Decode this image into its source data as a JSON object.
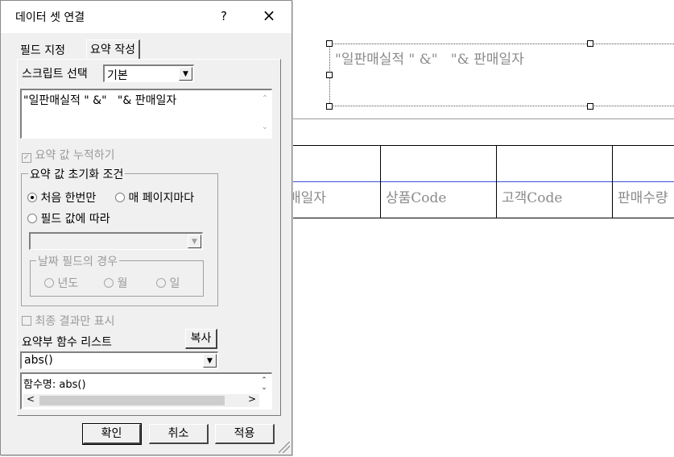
{
  "dialog": {
    "title": "데이터 셋 연결",
    "help_label": "?",
    "close_label": "×",
    "tabs": [
      {
        "label": "필드 지정",
        "active": false
      },
      {
        "label": "요약 작성",
        "active": true
      }
    ],
    "script_select": {
      "label": "스크립트 선택",
      "value": "기본"
    },
    "script_text": "\"일판매실적 \" &\"   \"& 판매일자",
    "accumulate_checkbox": {
      "label": "요약 값 누적하기",
      "checked": true,
      "enabled": false
    },
    "reset_group": {
      "title": "요약 값 초기화 조건",
      "options": {
        "first_only": {
          "label": "처음 한번만",
          "selected": true
        },
        "every_page": {
          "label": "매 페이지마다",
          "selected": false
        },
        "by_field": {
          "label": "필드 값에 따라",
          "selected": false
        }
      },
      "field_combo_value": "",
      "date_group": {
        "title": "날짜 필드의 경우",
        "options": [
          {
            "label": "년도"
          },
          {
            "label": "월"
          },
          {
            "label": "일"
          }
        ]
      }
    },
    "final_only_checkbox": {
      "label": "최종 결과만 표시",
      "checked": false,
      "enabled": false
    },
    "function_list": {
      "label": "요약부 함수 리스트",
      "copy_button": "복사",
      "value": "abs()"
    },
    "function_info": "함수명: abs()",
    "buttons": {
      "ok": "확인",
      "cancel": "취소",
      "apply": "적용"
    }
  },
  "canvas": {
    "textbox_text": "\"일판매실적 \" &\"   \"& 판매일자",
    "header_cells": [
      "매일자",
      "상품Code",
      "고객Code",
      "판매수량"
    ]
  }
}
